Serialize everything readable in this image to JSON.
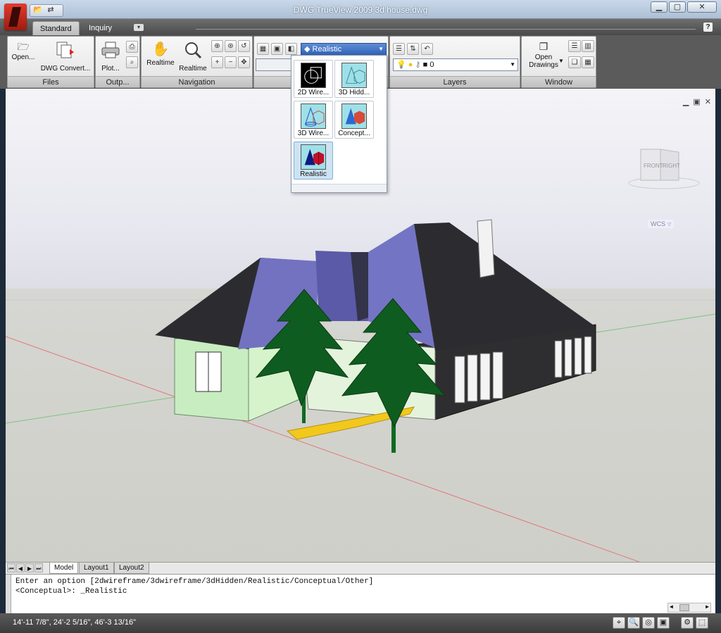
{
  "window": {
    "title": "DWG TrueView 2009 3d house.dwg",
    "buttons": {
      "minimize": "▁",
      "maximize": "▢",
      "close": "✕"
    }
  },
  "qat": {
    "open_icon": "📂",
    "convert_icon": "⇄"
  },
  "tabs": [
    {
      "label": "Standard"
    },
    {
      "label": "Inquiry"
    }
  ],
  "tab_toggle": "▾",
  "help_label": "?",
  "ribbon": {
    "files": {
      "title": "Files",
      "open": "Open...",
      "convert": "DWG Convert..."
    },
    "output": {
      "title": "Outp...",
      "plot": "Plot..."
    },
    "navigation": {
      "title": "Navigation",
      "pan": "Realtime",
      "zoom": "Realtime"
    },
    "visual_style": {
      "selected": "Realistic"
    },
    "layers": {
      "title": "Layers",
      "current": "0"
    },
    "window": {
      "title": "Window",
      "open_drawings": "Open Drawings"
    }
  },
  "visual_styles": [
    {
      "label": "2D Wire..."
    },
    {
      "label": "3D Hidd..."
    },
    {
      "label": "3D Wire..."
    },
    {
      "label": "Concept..."
    },
    {
      "label": "Realistic"
    }
  ],
  "viewport": {
    "controls": {
      "minimize": "▁",
      "restore": "▣",
      "close": "✕"
    },
    "viewcube": {
      "front": "FRONT",
      "right": "RIGHT"
    },
    "wcs": "WCS"
  },
  "layout_tabs": [
    {
      "label": "Model"
    },
    {
      "label": "Layout1"
    },
    {
      "label": "Layout2"
    }
  ],
  "nav_arrows": [
    "⏮",
    "◀",
    "▶",
    "⏭"
  ],
  "command": {
    "line1": "Enter an option [2dwireframe/3dwireframe/3dHidden/Realistic/Conceptual/Other]",
    "line2": "<Conceptual>: _Realistic"
  },
  "status": {
    "coordinates": "14'-11 7/8\", 24'-2 5/16\", 46'-3 13/16\"",
    "icons": [
      "⌖",
      "🔍",
      "◎",
      "▣",
      "⚙",
      "⬚"
    ]
  },
  "colors": {
    "roof": "#2c2c30",
    "roof_blue": "#7272c0",
    "wall_green": "#c8edc0",
    "wall_dark": "#2e2e30",
    "tree": "#0f5c20",
    "path": "#f2c81c"
  }
}
